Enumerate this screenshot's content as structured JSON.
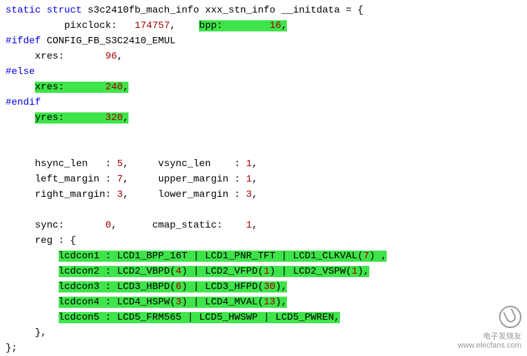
{
  "decl": {
    "kw1": "static",
    "kw2": "struct",
    "type": "s3c2410fb_mach_info",
    "var": "xxx_stn_info",
    "attr": "__initdata",
    "eq": "= {"
  },
  "pixclock_lbl": "pixclock:",
  "pixclock_val": "174757",
  "bpp_lbl": "bpp:",
  "bpp_val": "16",
  "ifdef": "#ifdef",
  "ifdef_sym": "CONFIG_FB_S3C2410_EMUL",
  "xres96_lbl": "xres:",
  "xres96_val": "96",
  "else": "#else",
  "xres240_lbl": "xres:",
  "xres240_val": "240",
  "endif": "#endif",
  "yres_lbl": "yres:",
  "yres_val": "320",
  "hsync_lbl": "hsync_len   :",
  "hsync_val": "5",
  "vsync_lbl": "vsync_len    :",
  "vsync_val": "1",
  "lmarg_lbl": "left_margin :",
  "lmarg_val": "7",
  "umarg_lbl": "upper_margin :",
  "umarg_val": "1",
  "rmarg_lbl": "right_margin:",
  "rmarg_val": "3",
  "lomarg_lbl": "lower_margin :",
  "lomarg_val": "3",
  "sync_lbl": "sync:",
  "sync_val": "0",
  "cmap_lbl": "cmap_static:",
  "cmap_val": "1",
  "reg_lbl": "reg : {",
  "l1a": "lcdcon1 : LCD1_BPP_16T | LCD1_PNR_TFT | LCD1_CLKVAL(",
  "l1n": "7",
  "l1b": ") ,",
  "l2a": "lcdcon2 : LCD2_VBPD(",
  "l2an": "4",
  "l2b": ") | LCD2_VFPD(",
  "l2bn": "1",
  "l2c": ") | LCD2_VSPW(",
  "l2cn": "1",
  "l2d": "),",
  "l3a": "lcdcon3 : LCD3_HBPD(",
  "l3an": "6",
  "l3b": ") | LCD3_HFPD(",
  "l3bn": "30",
  "l3c": "),",
  "l4a": "lcdcon4 : LCD4_HSPW(",
  "l4an": "3",
  "l4b": ") | LCD4_MVAL(",
  "l4bn": "13",
  "l4c": "),",
  "l5": "lcdcon5 : LCD5_FRM565 | LCD5_HWSWP | LCD5_PWREN,",
  "brace_close": "},",
  "struct_close": "};",
  "wm_top": "电子发烧友",
  "wm_bot": "www.elecfans.com",
  "chart_data": {
    "type": "table",
    "fields": {
      "pixclock": 174757,
      "bpp": 16,
      "xres_emul": 96,
      "xres": 240,
      "yres": 320,
      "hsync_len": 5,
      "vsync_len": 1,
      "left_margin": 7,
      "upper_margin": 1,
      "right_margin": 3,
      "lower_margin": 3,
      "sync": 0,
      "cmap_static": 1,
      "lcdcon1": "LCD1_BPP_16T | LCD1_PNR_TFT | LCD1_CLKVAL(7)",
      "lcdcon2": "LCD2_VBPD(4) | LCD2_VFPD(1) | LCD2_VSPW(1)",
      "lcdcon3": "LCD3_HBPD(6) | LCD3_HFPD(30)",
      "lcdcon4": "LCD4_HSPW(3) | LCD4_MVAL(13)",
      "lcdcon5": "LCD5_FRM565 | LCD5_HWSWP | LCD5_PWREN"
    }
  }
}
